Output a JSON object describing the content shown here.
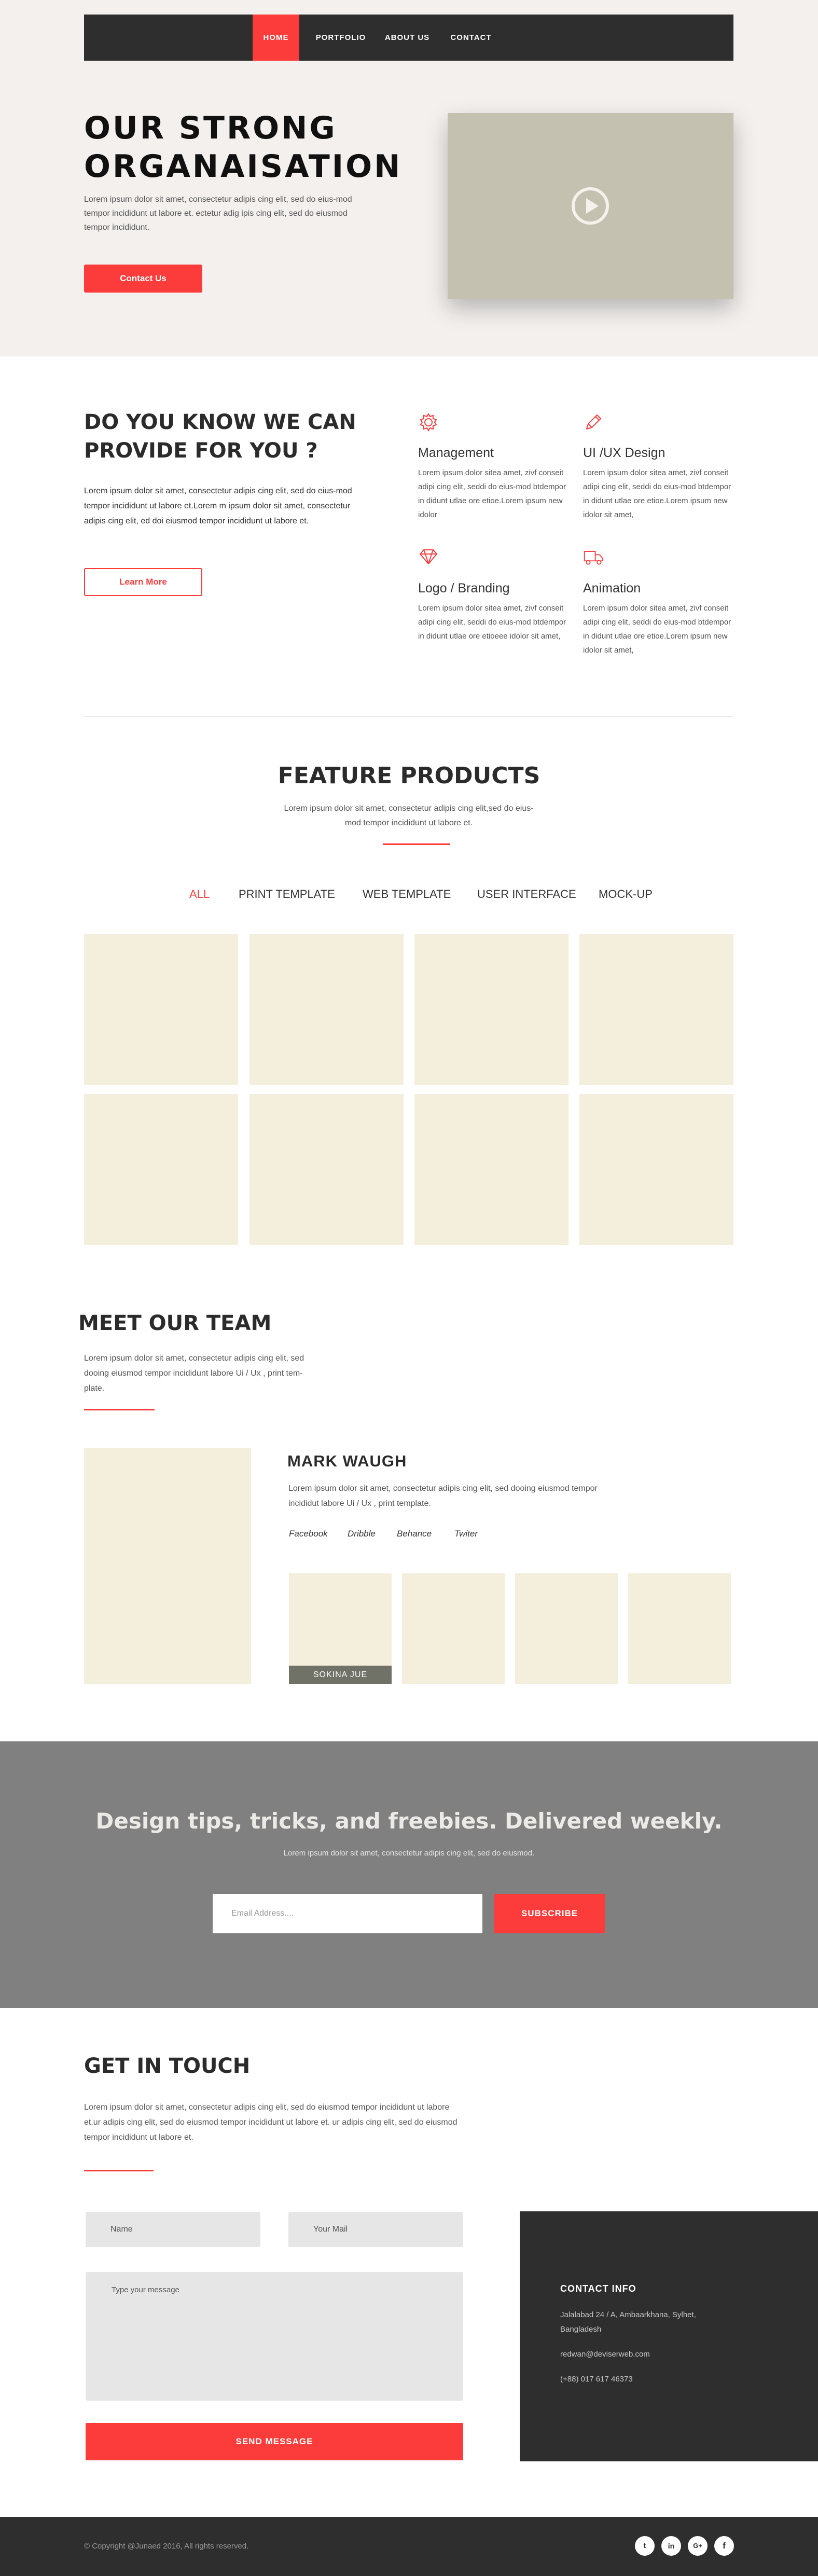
{
  "nav": {
    "items": [
      {
        "label": "HOME"
      },
      {
        "label": "PORTFOLIO"
      },
      {
        "label": "ABOUT US"
      },
      {
        "label": "CONTACT"
      }
    ]
  },
  "hero": {
    "title_line1": "OUR STRONG",
    "title_line2": "ORGANAISATION",
    "text": "Lorem ipsum dolor sit amet, consectetur adipis cing elit, sed do eius-mod tempor incididunt  ut labore et. ectetur adig ipis cing elit, sed do eiusmod tempor incididunt.",
    "button_label": "Contact Us",
    "video_icon": "play-icon"
  },
  "provide": {
    "title": "DO YOU KNOW WE CAN PROVIDE FOR YOU ?",
    "text": "Lorem ipsum dolor sit amet, consectetur adipis cing elit, sed do eius-mod tempor incididunt ut labore et.Lorem m ipsum dolor sit amet, consectetur adipis cing elit, ed doi eiusmod tempor incididunt ut labore et.",
    "button_label": "Learn More",
    "services": [
      {
        "icon": "gear-icon",
        "title": "Management",
        "text": "Lorem ipsum dolor sitea amet, zivf conseit  adipi cing elit, seddi do eius-mod btdempor in didunt utlae ore etioe.Lorem ipsum new idolor"
      },
      {
        "icon": "pencil-icon",
        "title": "UI /UX Design",
        "text": "Lorem ipsum dolor sitea amet, zivf conseit  adipi cing elit, seddi do eius-mod btdempor in didunt utlae ore etioe.Lorem ipsum new idolor sit amet,"
      },
      {
        "icon": "diamond-icon",
        "title": "Logo / Branding",
        "text": "Lorem ipsum dolor sitea amet, zivf conseit  adipi cing elit, seddi do eius-mod btdempor in didunt utlae ore etioeee idolor sit amet,"
      },
      {
        "icon": "truck-icon",
        "title": "Animation",
        "text": "Lorem ipsum dolor sitea amet, zivf conseit  adipi cing elit, seddi do eius-mod btdempor in didunt utlae ore etioe.Lorem ipsum new idolor sit amet,"
      }
    ]
  },
  "feature": {
    "title": "FEATURE PRODUCTS",
    "text": "Lorem ipsum dolor sit amet, consectetur adipis cing elit,sed do eius-mod tempor incididunt ut labore et.",
    "filters": [
      "ALL",
      "PRINT TEMPLATE",
      "WEB TEMPLATE",
      "USER INTERFACE",
      "MOCK-UP"
    ]
  },
  "team": {
    "title": "MEET OUR TEAM",
    "text": "Lorem ipsum dolor sit amet, consectetur adipis cing elit, sed dooing eiusmod tempor incididunt labore Ui / Ux , print tem-plate.",
    "member_name": "MARK WAUGH",
    "member_text": "Lorem ipsum dolor sit amet, consectetur adipis cing elit, sed dooing eiusmod tempor incididut labore Ui / Ux , print template.",
    "social": [
      "Facebook",
      "Dribble",
      "Behance",
      "Twiter"
    ],
    "thumb_label": "SOKINA JUE"
  },
  "newsletter": {
    "title": "Design tips, tricks, and freebies. Delivered weekly.",
    "text": "Lorem ipsum dolor sit amet, consectetur adipis cing elit, sed do eiusmod.",
    "placeholder": "Email Address....",
    "button_label": "SUBSCRIBE"
  },
  "contact": {
    "title": "GET IN TOUCH",
    "text": "Lorem ipsum dolor sit amet, consectetur adipis cing elit, sed do eiusmod tempor incididunt ut labore et.ur adipis cing elit, sed do eiusmod tempor incididunt ut labore et. ur adipis cing elit, sed do eiusmod tempor incididunt ut labore et.",
    "name_placeholder": "Name",
    "mail_placeholder": "Your Mail",
    "message_placeholder": "Type your message",
    "button_label": "SEND MESSAGE",
    "info": {
      "title": "CONTACT INFO",
      "address": "Jalalabad 24 / A, Ambaarkhana, Sylhet, Bangladesh",
      "email": "redwan@deviserweb.com",
      "phone": "(+88) 017 617 46373"
    }
  },
  "footer": {
    "copyright": "© Copyright @Junaed 2016, All rights reserved.",
    "social": [
      "twitter-icon",
      "linkedin-icon",
      "google-plus-icon",
      "facebook-icon"
    ],
    "social_glyphs": [
      "t",
      "in",
      "G+",
      "f"
    ]
  },
  "colors": {
    "accent": "#fc3b3b",
    "dark": "#2e2e2e",
    "hero_bg": "#f3f0ee",
    "placeholder": "#f4eedc",
    "newsletter_bg": "#808080"
  }
}
